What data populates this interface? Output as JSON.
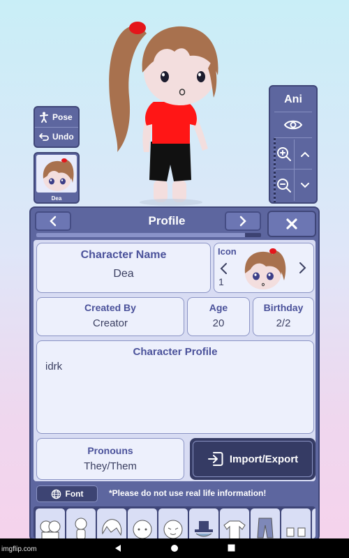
{
  "colors": {
    "panel": "#5d669f",
    "panel_dark": "#3f4678",
    "card": "#edf0fc",
    "label": "#4a519a",
    "shirt": "#ff1616",
    "hair": "#a8714e"
  },
  "tools": {
    "pose_label": "Pose",
    "undo_label": "Undo"
  },
  "selected_character": {
    "name": "Dea"
  },
  "camera": {
    "ani_label": "Ani"
  },
  "profile": {
    "title": "Profile",
    "page_progress": 0.93,
    "character_name_label": "Character Name",
    "character_name": "Dea",
    "icon_label": "Icon",
    "icon_index": "1",
    "created_by_label": "Created By",
    "created_by": "Creator",
    "age_label": "Age",
    "age": "20",
    "birthday_label": "Birthday",
    "birthday": "2/2",
    "character_profile_label": "Character Profile",
    "character_profile": "idrk",
    "pronouns_label": "Pronouns",
    "pronouns": "They/Them",
    "import_export_label": "Import/Export",
    "font_label": "Font",
    "warning": "*Please do not use real life information!"
  },
  "watermark": "imgflip.com",
  "icons": [
    "person-pose-icon",
    "undo-icon",
    "eye-icon",
    "zoom-in-icon",
    "zoom-out-icon",
    "chevron-up-icon",
    "chevron-down-icon",
    "chevron-left-icon",
    "chevron-right-icon",
    "close-icon",
    "import-icon",
    "globe-icon",
    "back-icon",
    "home-icon",
    "recent-apps-icon"
  ]
}
